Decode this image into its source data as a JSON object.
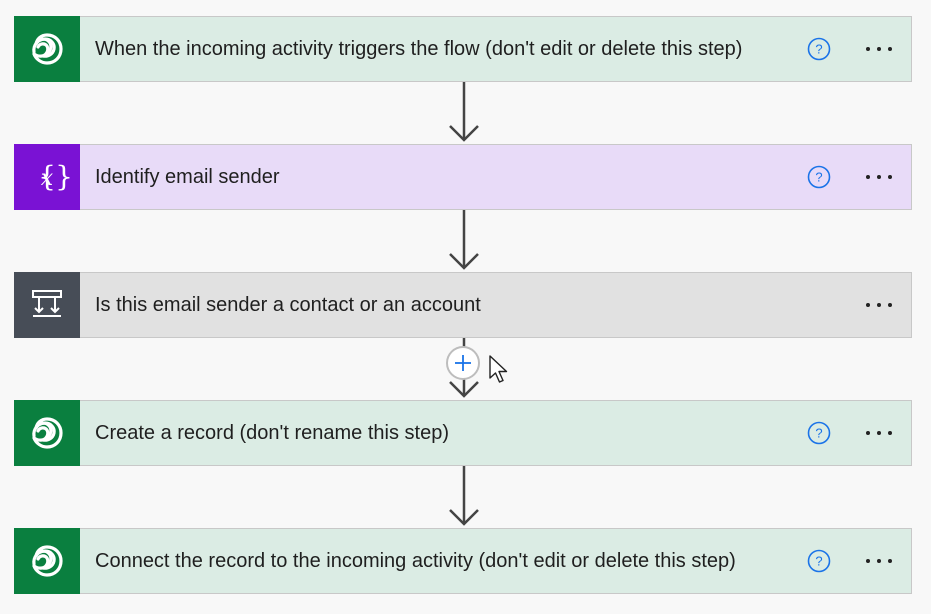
{
  "flow": {
    "steps": [
      {
        "title": "When the incoming activity triggers the flow (don't edit or delete this step)",
        "icon": "dataverse-icon",
        "theme": "green",
        "has_help": true
      },
      {
        "title": "Identify email sender",
        "icon": "variable-icon",
        "theme": "purple",
        "has_help": true
      },
      {
        "title": "Is this email sender a contact or an account",
        "icon": "condition-icon",
        "theme": "gray",
        "has_help": false
      },
      {
        "title": "Create a record (don't rename this step)",
        "icon": "dataverse-icon",
        "theme": "green",
        "has_help": true
      },
      {
        "title": "Connect the record to the incoming activity (don't edit or delete this step)",
        "icon": "dataverse-icon",
        "theme": "green",
        "has_help": true
      }
    ],
    "add_step_symbol": "+"
  },
  "colors": {
    "green_icon_bg": "#0a7f3f",
    "green_card_bg": "#dbece4",
    "purple_icon_bg": "#7a12d4",
    "purple_card_bg": "#e8dbf8",
    "gray_icon_bg": "#474d57",
    "gray_card_bg": "#e1e1e1",
    "help_blue": "#1a73e8"
  }
}
